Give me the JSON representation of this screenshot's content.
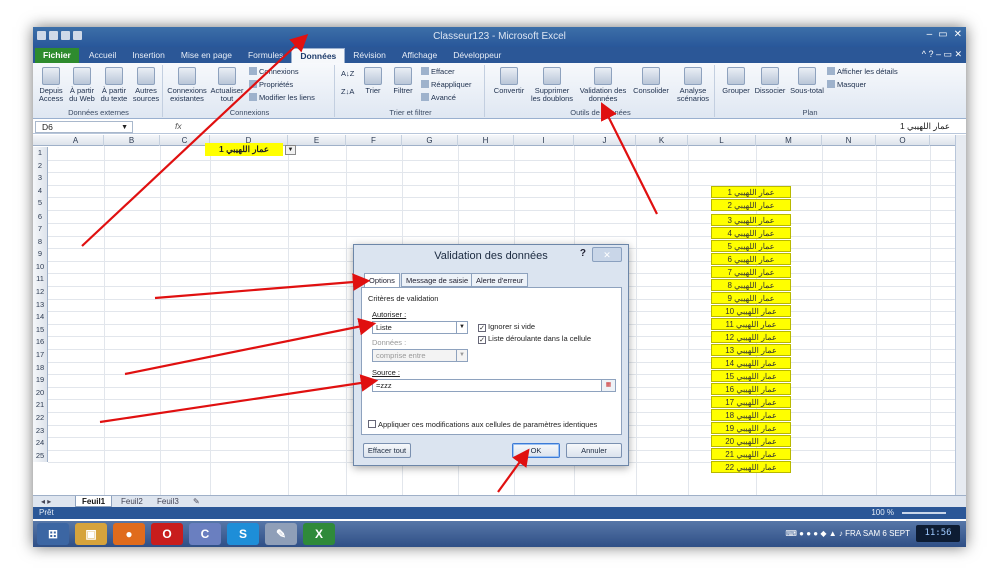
{
  "window": {
    "title": "Classeur123 - Microsoft Excel"
  },
  "tabs": [
    {
      "label": "Fichier"
    },
    {
      "label": "Accueil"
    },
    {
      "label": "Insertion"
    },
    {
      "label": "Mise en page"
    },
    {
      "label": "Formules"
    },
    {
      "label": "Données"
    },
    {
      "label": "Révision"
    },
    {
      "label": "Affichage"
    },
    {
      "label": "Développeur"
    }
  ],
  "ribbon": {
    "ext": {
      "b1": "Depuis Access",
      "b2": "À partir du Web",
      "b3": "À partir du texte",
      "b4": "Autres sources",
      "group": "Données externes"
    },
    "conn": {
      "b1": "Connexions existantes",
      "b2": "Actualiser tout",
      "s1": "Connexions",
      "s2": "Propriétés",
      "s3": "Modifier les liens",
      "group": "Connexions"
    },
    "sort": {
      "b1": "Trier",
      "b2": "Filtrer",
      "s1": "Effacer",
      "s2": "Réappliquer",
      "s3": "Avancé",
      "group": "Trier et filtrer"
    },
    "tools": {
      "b1": "Convertir",
      "b2": "Supprimer les doublons",
      "b3": "Validation des données",
      "b4": "Consolider",
      "b5": "Analyse scénarios",
      "group": "Outils de données"
    },
    "plan": {
      "b1": "Grouper",
      "b2": "Dissocier",
      "b3": "Sous-total",
      "s1": "Afficher les détails",
      "s2": "Masquer",
      "group": "Plan"
    }
  },
  "formula_bar": {
    "name_box": "D6",
    "fx": "fx",
    "value": "عمار اللهيبي 1"
  },
  "columns": [
    "A",
    "B",
    "C",
    "D",
    "E",
    "F",
    "G",
    "H",
    "I",
    "J",
    "K",
    "L",
    "M",
    "N",
    "O",
    "P"
  ],
  "rows": [
    "1",
    "2",
    "3",
    "4",
    "5",
    "6",
    "7",
    "8",
    "9",
    "10",
    "11",
    "12",
    "13",
    "14",
    "15",
    "16",
    "17",
    "18",
    "19",
    "20",
    "21",
    "22",
    "23",
    "24",
    "25"
  ],
  "cell_d6": "عمار اللهيبي 1",
  "list_m": [
    "عمار اللهيبي 1",
    "عمار اللهيبي 2",
    "عمار اللهيبي 3",
    "عمار اللهيبي 4",
    "عمار اللهيبي 5",
    "عمار اللهيبي 6",
    "عمار اللهيبي 7",
    "عمار اللهيبي 8",
    "عمار اللهيبي 9",
    "عمار اللهيبي 10",
    "عمار اللهيبي 11",
    "عمار اللهيبي 12",
    "عمار اللهيبي 13",
    "عمار اللهيبي 14",
    "عمار اللهيبي 15",
    "عمار اللهيبي 16",
    "عمار اللهيبي 17",
    "عمار اللهيبي 18",
    "عمار اللهيبي 19",
    "عمار اللهيبي 20",
    "عمار اللهيبي 21",
    "عمار اللهيبي 22"
  ],
  "sheets": [
    "Feuil1",
    "Feuil2",
    "Feuil3"
  ],
  "status": {
    "mode": "Prêt",
    "zoom": "100 %"
  },
  "taskbar": {
    "lang": "FRA",
    "date": "SAM 6 SEPT",
    "time": "11:56"
  },
  "dialog": {
    "title": "Validation des données",
    "help": "?",
    "tabs": [
      "Options",
      "Message de saisie",
      "Alerte d'erreur"
    ],
    "criteria": "Critères de validation",
    "allow_label": "Autoriser :",
    "allow_value": "Liste",
    "data_label": "Données :",
    "data_value": "comprise entre",
    "ignore_blank": "Ignorer si vide",
    "dropdown": "Liste déroulante dans la cellule",
    "source_label": "Source :",
    "source_value": "=zzz",
    "apply_all": "Appliquer ces modifications aux cellules de paramètres identiques",
    "clear_all": "Effacer tout",
    "ok": "OK",
    "cancel": "Annuler"
  },
  "colors": {
    "accent": "#2b5797",
    "highlight": "#ffff00",
    "arrow": "#e01010"
  }
}
